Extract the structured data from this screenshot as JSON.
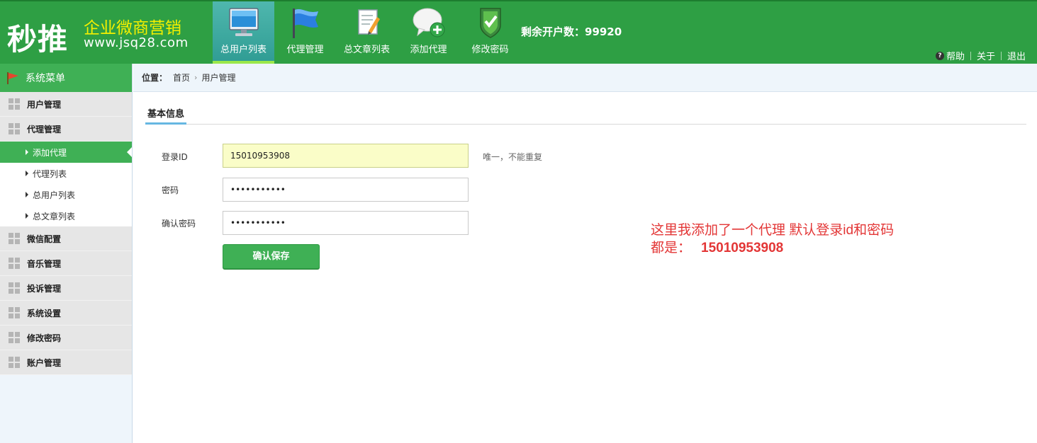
{
  "logo": {
    "big": "秒推",
    "slogan": "企业微商营销",
    "url": "www.jsq28.com"
  },
  "nav": [
    {
      "label": "总用户列表",
      "icon": "monitor-icon",
      "active": true
    },
    {
      "label": "代理管理",
      "icon": "flag-icon",
      "active": false
    },
    {
      "label": "总文章列表",
      "icon": "document-icon",
      "active": false
    },
    {
      "label": "添加代理",
      "icon": "chat-add-icon",
      "active": false
    },
    {
      "label": "修改密码",
      "icon": "shield-check-icon",
      "active": false
    }
  ],
  "remain": "剩余开户数：99920",
  "toplinks": {
    "help": "帮助",
    "about": "关于",
    "logout": "退出"
  },
  "sidebar": {
    "title": "系统菜单",
    "groups": [
      {
        "label": "用户管理"
      },
      {
        "label": "代理管理",
        "items": [
          {
            "label": "添加代理",
            "active": true
          },
          {
            "label": "代理列表"
          },
          {
            "label": "总用户列表"
          },
          {
            "label": "总文章列表"
          }
        ]
      },
      {
        "label": "微信配置"
      },
      {
        "label": "音乐管理"
      },
      {
        "label": "投诉管理"
      },
      {
        "label": "系统设置"
      },
      {
        "label": "修改密码"
      },
      {
        "label": "账户管理"
      }
    ]
  },
  "breadcrumb": {
    "label": "位置：",
    "home": "首页",
    "current": "用户管理"
  },
  "tab": "基本信息",
  "form": {
    "login_id": {
      "label": "登录ID",
      "value": "15010953908",
      "hint": "唯一，不能重复"
    },
    "password": {
      "label": "密码",
      "value": "•••••••••••"
    },
    "confirm": {
      "label": "确认密码",
      "value": "•••••••••••"
    },
    "save": "确认保存"
  },
  "annotation": {
    "line1": "这里我添加了一个代理 默认登录id和密码",
    "line2_prefix": "都是：",
    "line2_id": "15010953908"
  },
  "colors": {
    "header_green": "#2e9f44",
    "active_green": "#3fb055",
    "annotation_red": "#e33636"
  }
}
